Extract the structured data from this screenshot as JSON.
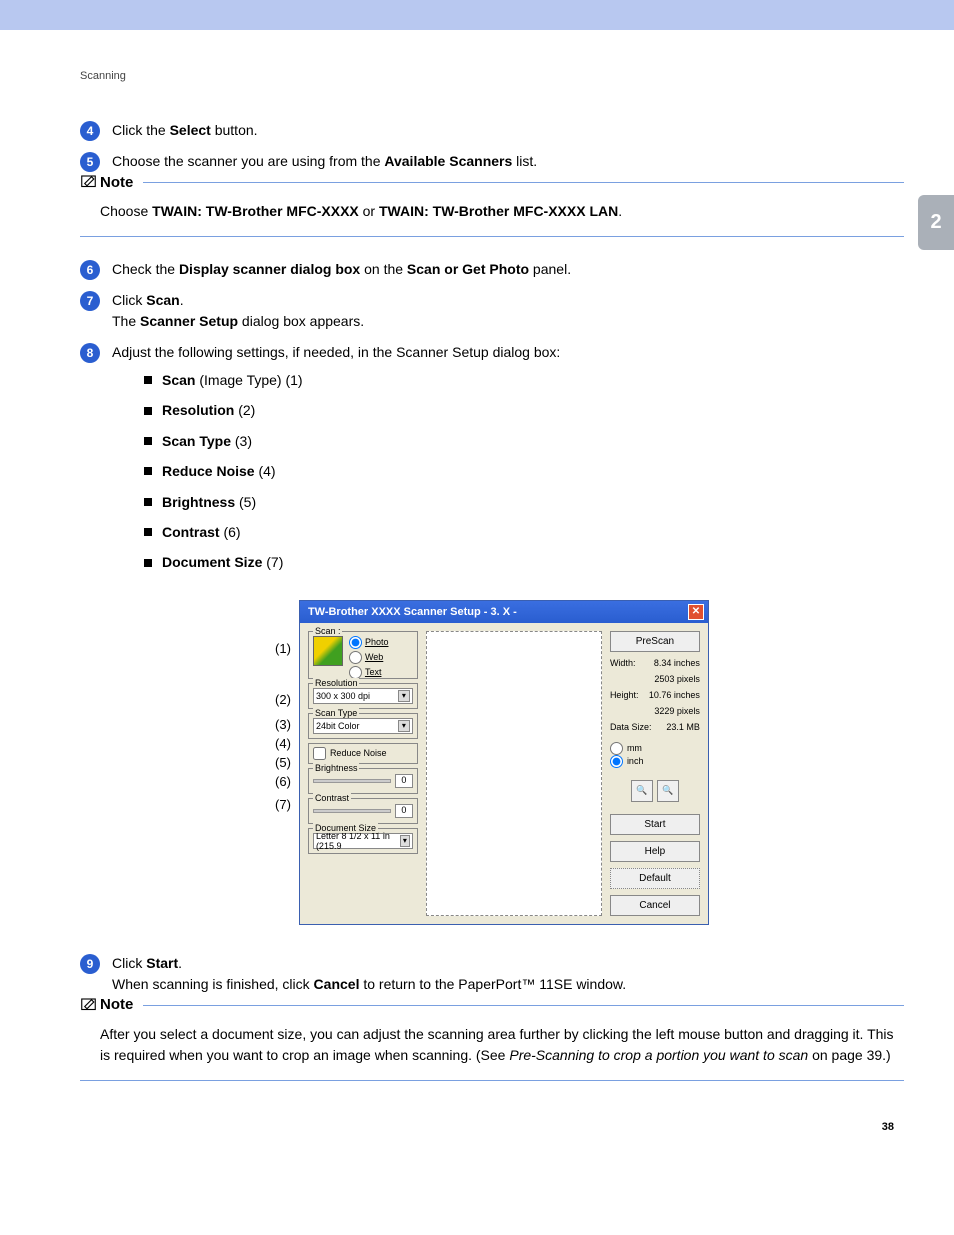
{
  "breadcrumb": "Scanning",
  "chapterTab": "2",
  "pageNumber": "38",
  "steps": {
    "s4_a": "Click the ",
    "s4_b": "Select",
    "s4_c": " button.",
    "s5_a": "Choose the scanner you are using from the ",
    "s5_b": "Available Scanners",
    "s5_c": " list.",
    "s6_a": "Check the ",
    "s6_b": "Display scanner dialog box",
    "s6_c": " on the ",
    "s6_d": "Scan or Get Photo",
    "s6_e": " panel.",
    "s7_a": "Click ",
    "s7_b": "Scan",
    "s7_c": ".",
    "s7_d": "The ",
    "s7_e": "Scanner Setup",
    "s7_f": " dialog box appears.",
    "s8": "Adjust the following settings, if needed, in the Scanner Setup dialog box:",
    "s9_a": "Click ",
    "s9_b": "Start",
    "s9_c": ".",
    "s9_d": "When scanning is finished, click ",
    "s9_e": "Cancel",
    "s9_f": " to return to the PaperPort™ 11SE window."
  },
  "note1": {
    "title": "Note",
    "a": "Choose ",
    "b": "TWAIN: TW-Brother MFC-XXXX",
    "c": " or ",
    "d": "TWAIN: TW-Brother MFC-XXXX LAN",
    "e": "."
  },
  "note2": {
    "title": "Note",
    "a": "After you select a document size, you can adjust the scanning area further by clicking the left mouse button and dragging it. This is required when you want to crop an image when scanning. (See ",
    "b": "Pre-Scanning to crop a portion you want to scan",
    "c": " on page 39.)"
  },
  "bullets": {
    "b1a": "Scan",
    "b1b": " (Image Type) (1)",
    "b2a": "Resolution",
    "b2b": " (2)",
    "b3a": "Scan Type",
    "b3b": " (3)",
    "b4a": "Reduce Noise",
    "b4b": " (4)",
    "b5a": "Brightness",
    "b5b": " (5)",
    "b6a": "Contrast",
    "b6b": " (6)",
    "b7a": "Document Size",
    "b7b": " (7)"
  },
  "callouts": {
    "c1": "(1)",
    "c2": "(2)",
    "c3": "(3)",
    "c4": "(4)",
    "c5": "(5)",
    "c6": "(6)",
    "c7": "(7)"
  },
  "dialog": {
    "title": "TW-Brother XXXX Scanner Setup - 3. X -",
    "scanLabel": "Scan :",
    "photo": "Photo",
    "web": "Web",
    "text": "Text",
    "resolutionLabel": "Resolution",
    "resolutionValue": "300 x 300 dpi",
    "scanTypeLabel": "Scan Type",
    "scanTypeValue": "24bit Color",
    "reduceNoise": "Reduce Noise",
    "brightnessLabel": "Brightness",
    "brightnessValue": "0",
    "contrastLabel": "Contrast",
    "contrastValue": "0",
    "docSizeLabel": "Document Size",
    "docSizeValue": "Letter 8 1/2 x 11 in (215.9",
    "prescan": "PreScan",
    "widthLabel": "Width:",
    "widthVal": "8.34 inches",
    "widthPx": "2503 pixels",
    "heightLabel": "Height:",
    "heightVal": "10.76 inches",
    "heightPx": "3229 pixels",
    "dataSizeLabel": "Data Size:",
    "dataSizeVal": "23.1 MB",
    "mm": "mm",
    "inch": "inch",
    "start": "Start",
    "help": "Help",
    "default": "Default",
    "cancel": "Cancel"
  }
}
